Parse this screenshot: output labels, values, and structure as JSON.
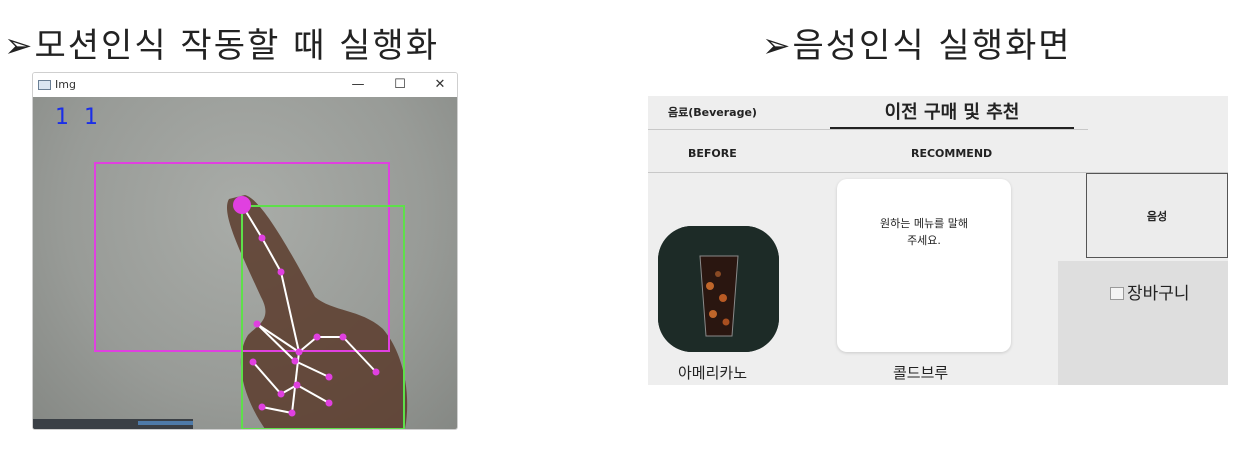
{
  "headings": {
    "left": "➢모션인식 작동할 때 실행화",
    "right": "➢음성인식 실행화면"
  },
  "cv_window": {
    "title": "Img",
    "minimize": "—",
    "maximize": "☐",
    "close": "✕",
    "counter": "1 1",
    "colors": {
      "bbox_magenta": "#e040e0",
      "bbox_green": "#5ee04a",
      "landmark": "#e040e0",
      "connection": "#ffffff",
      "counter": "#1a2ee8"
    }
  },
  "kiosk": {
    "category": "음료(Beverage)",
    "title": "이전 구매 및 추천",
    "tabs": {
      "before": "BEFORE",
      "recommend": "RECOMMEND"
    },
    "voice_button": "음성",
    "cart_label": "장바구니",
    "modal": {
      "line1": "원하는 메뉴를 말해",
      "line2": "주세요."
    },
    "products": [
      {
        "name": "아메리카노"
      },
      {
        "name": "콜드브루"
      }
    ]
  }
}
